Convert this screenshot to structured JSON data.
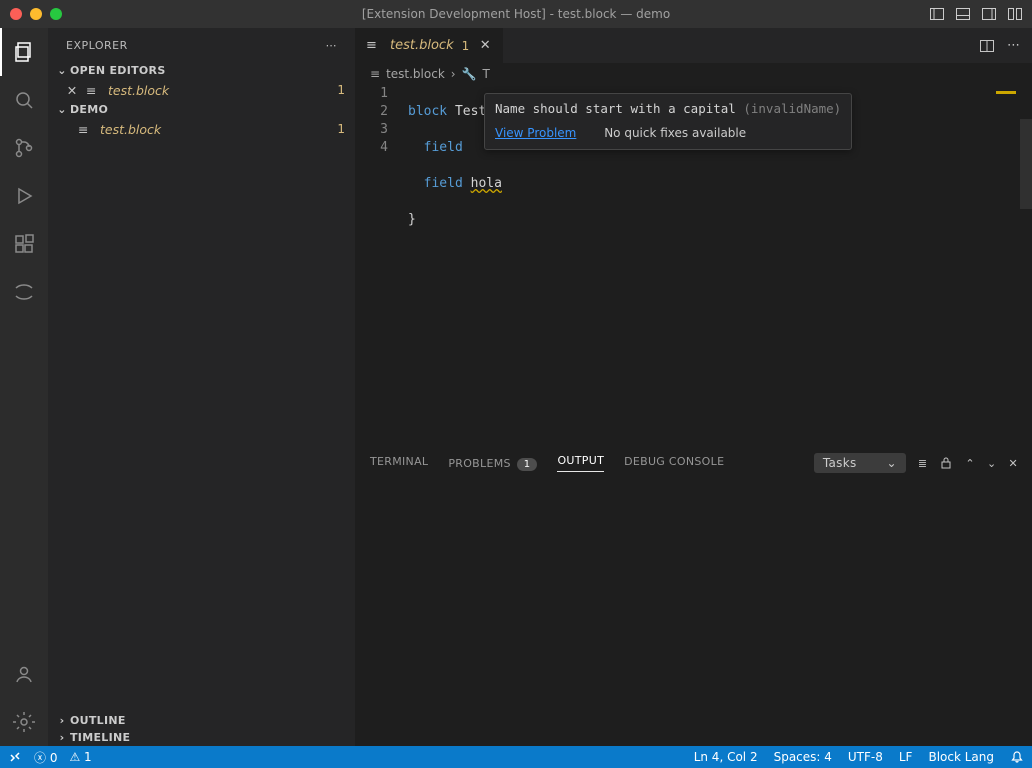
{
  "titlebar": {
    "title": "[Extension Development Host] - test.block — demo"
  },
  "sidebar": {
    "title": "EXPLORER",
    "open_editors_label": "OPEN EDITORS",
    "open_editor_file": "test.block",
    "open_editor_badge": "1",
    "folder_label": "DEMO",
    "folder_file": "test.block",
    "folder_badge": "1",
    "outline_label": "OUTLINE",
    "timeline_label": "TIMELINE"
  },
  "tab": {
    "name": "test.block",
    "badge": "1"
  },
  "breadcrumbs": {
    "file": "test.block",
    "symbol": "T"
  },
  "editor": {
    "line_numbers": [
      "1",
      "2",
      "3",
      "4"
    ],
    "tok": {
      "l1a": "block ",
      "l1b": "Test ",
      "l1c": "{",
      "l2a": "  field ",
      "l3a": "  field ",
      "l3b": "hola",
      "l4a": "}"
    }
  },
  "hover": {
    "message": "Name should start with a capital ",
    "code_id": "(invalidName)",
    "view_problem": "View Problem",
    "no_fixes": "No quick fixes available"
  },
  "panel": {
    "terminal": "TERMINAL",
    "problems": "PROBLEMS",
    "problems_count": "1",
    "output": "OUTPUT",
    "debug_console": "DEBUG CONSOLE",
    "tasks": "Tasks"
  },
  "status": {
    "errors": "0",
    "warnings": "1",
    "cursor": "Ln 4, Col 2",
    "spaces": "Spaces: 4",
    "encoding": "UTF-8",
    "eol": "LF",
    "language": "Block Lang"
  }
}
